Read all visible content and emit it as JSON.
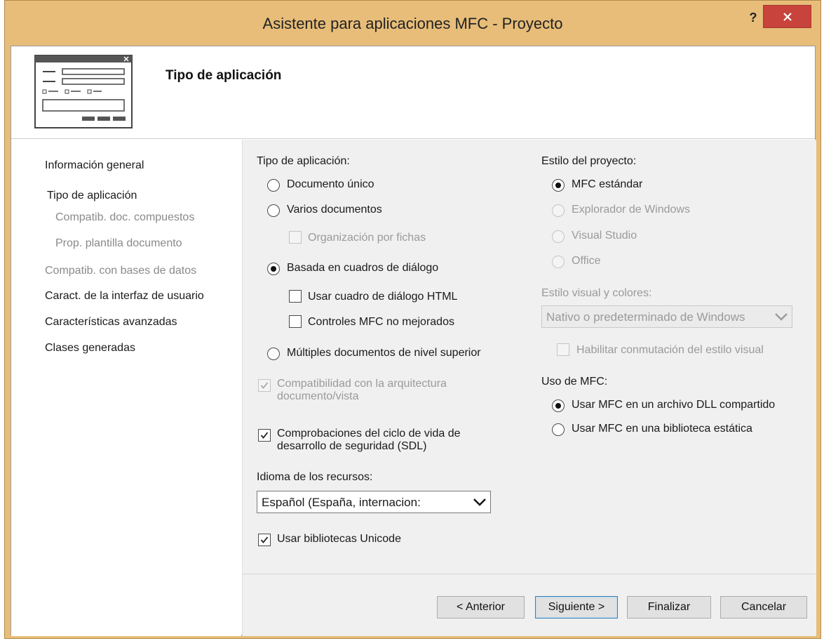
{
  "window": {
    "title": "Asistente para aplicaciones MFC - Proyecto",
    "help_label": "?"
  },
  "header": {
    "title": "Tipo de aplicación"
  },
  "sidebar": {
    "items": [
      {
        "label": "Información general",
        "enabled": true
      },
      {
        "label": "Tipo de aplicación",
        "enabled": true,
        "selected": true
      },
      {
        "label": "Compatib. doc. compuestos",
        "enabled": false
      },
      {
        "label": "Prop. plantilla documento",
        "enabled": false
      },
      {
        "label": "Compatib. con bases de datos",
        "enabled": false
      },
      {
        "label": "Caract. de la interfaz de usuario",
        "enabled": true
      },
      {
        "label": "Características avanzadas",
        "enabled": true
      },
      {
        "label": "Clases generadas",
        "enabled": true
      }
    ]
  },
  "app_type": {
    "heading": "Tipo de aplicación:",
    "options": [
      {
        "label": "Documento único",
        "checked": false
      },
      {
        "label": "Varios documentos",
        "checked": false
      },
      {
        "label": "Basada en cuadros de diálogo",
        "checked": true
      },
      {
        "label": "Múltiples documentos de nivel superior",
        "checked": false
      }
    ],
    "tabbed": {
      "label": "Organización por fichas",
      "checked": false,
      "enabled": false
    },
    "html_dialog": {
      "label": "Usar cuadro de diálogo HTML",
      "checked": false
    },
    "mfc_controls": {
      "label": "Controles MFC no mejorados",
      "checked": false
    },
    "doc_view": {
      "label_line1": "Compatibilidad con la arquitectura",
      "label_line2": "documento/vista",
      "checked": true,
      "enabled": false
    },
    "sdl": {
      "label_line1": "Comprobaciones del ciclo de vida de",
      "label_line2": "desarrollo de seguridad (SDL)",
      "checked": true
    },
    "resource_lang_label": "Idioma de los recursos:",
    "resource_lang_value": "Español (España, internacion:",
    "unicode": {
      "label": "Usar bibliotecas Unicode",
      "checked": true
    }
  },
  "project_style": {
    "heading": "Estilo del proyecto:",
    "options": [
      {
        "label": "MFC estándar",
        "checked": true,
        "enabled": true
      },
      {
        "label": "Explorador de Windows",
        "checked": false,
        "enabled": false
      },
      {
        "label": "Visual Studio",
        "checked": false,
        "enabled": false
      },
      {
        "label": "Office",
        "checked": false,
        "enabled": false
      }
    ],
    "visual_style_label": "Estilo visual y colores:",
    "visual_style_value": "Nativo o predeterminado de Windows",
    "enable_switch": {
      "label": "Habilitar conmutación del estilo visual",
      "checked": false,
      "enabled": false
    }
  },
  "mfc_use": {
    "heading": "Uso de MFC:",
    "options": [
      {
        "label": "Usar MFC en un archivo DLL compartido",
        "checked": true
      },
      {
        "label": "Usar MFC en una biblioteca estática",
        "checked": false
      }
    ]
  },
  "buttons": {
    "back": "< Anterior",
    "next": "Siguiente >",
    "finish": "Finalizar",
    "cancel": "Cancelar"
  },
  "colors": {
    "frame": "#e7bd79",
    "close": "#c8433b",
    "panel": "#f0f0f0"
  }
}
